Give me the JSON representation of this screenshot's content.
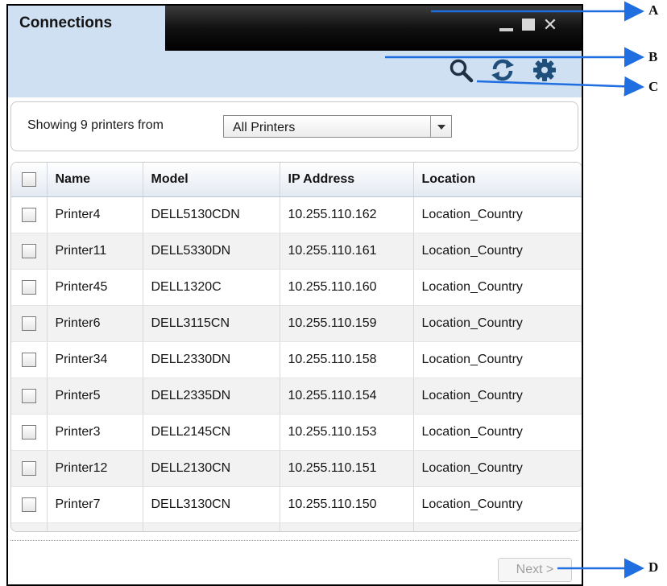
{
  "window": {
    "tab_label": "Connections",
    "controls": [
      "minimize-icon",
      "maximize-icon",
      "close-icon"
    ],
    "close_glyph": "✕"
  },
  "toolbar": {
    "icons": [
      "search-icon",
      "refresh-icon",
      "gear-icon"
    ]
  },
  "filter": {
    "label": "Showing 9 printers from",
    "selected": "All Printers"
  },
  "table": {
    "columns": [
      "Name",
      "Model",
      "IP Address",
      "Location"
    ],
    "rows": [
      {
        "name": "Printer4",
        "model": "DELL5130CDN",
        "ip": "10.255.110.162",
        "location": "Location_Country"
      },
      {
        "name": "Printer11",
        "model": "DELL5330DN",
        "ip": "10.255.110.161",
        "location": "Location_Country"
      },
      {
        "name": "Printer45",
        "model": "DELL1320C",
        "ip": "10.255.110.160",
        "location": "Location_Country"
      },
      {
        "name": "Printer6",
        "model": "DELL3115CN",
        "ip": "10.255.110.159",
        "location": "Location_Country"
      },
      {
        "name": "Printer34",
        "model": "DELL2330DN",
        "ip": "10.255.110.158",
        "location": "Location_Country"
      },
      {
        "name": "Printer5",
        "model": "DELL2335DN",
        "ip": "10.255.110.154",
        "location": "Location_Country"
      },
      {
        "name": "Printer3",
        "model": "DELL2145CN",
        "ip": "10.255.110.153",
        "location": "Location_Country"
      },
      {
        "name": "Printer12",
        "model": "DELL2130CN",
        "ip": "10.255.110.151",
        "location": "Location_Country"
      },
      {
        "name": "Printer7",
        "model": "DELL3130CN",
        "ip": "10.255.110.150",
        "location": "Location_Country"
      }
    ]
  },
  "footer": {
    "next_label": "Next >"
  },
  "annotations": {
    "a": "A",
    "b": "B",
    "c": "C",
    "d": "D"
  },
  "colors": {
    "tab_bg": "#cfe0f3",
    "titlebar_bg": "#000000",
    "arrow": "#1f6fe0"
  }
}
